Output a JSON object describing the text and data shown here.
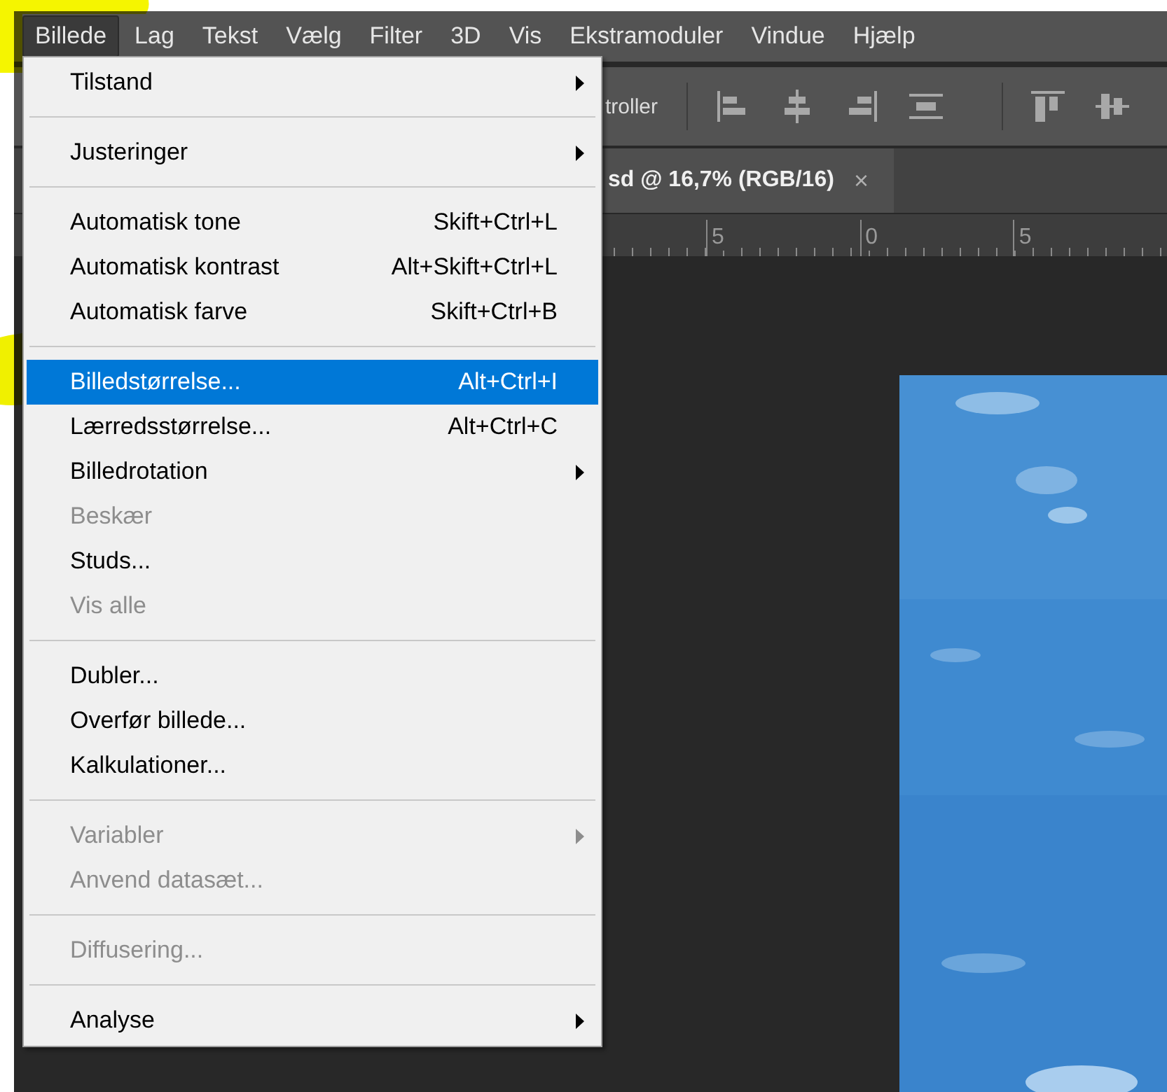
{
  "menubar": {
    "items": [
      {
        "label": "Billede",
        "selected": true
      },
      {
        "label": "Lag",
        "selected": false
      },
      {
        "label": "Tekst",
        "selected": false
      },
      {
        "label": "Vælg",
        "selected": false
      },
      {
        "label": "Filter",
        "selected": false
      },
      {
        "label": "3D",
        "selected": false
      },
      {
        "label": "Vis",
        "selected": false
      },
      {
        "label": "Ekstramoduler",
        "selected": false
      },
      {
        "label": "Vindue",
        "selected": false
      },
      {
        "label": "Hjælp",
        "selected": false
      }
    ]
  },
  "options_bar": {
    "label": "troller"
  },
  "document_tab": {
    "title": "sd @ 16,7% (RGB/16)",
    "close": "×"
  },
  "ruler": {
    "labels": [
      "5",
      "0",
      "5"
    ]
  },
  "menu": {
    "items": [
      {
        "kind": "item",
        "label": "Tilstand",
        "submenu": true,
        "disabled": false,
        "selected": false
      },
      {
        "kind": "separator"
      },
      {
        "kind": "item",
        "label": "Justeringer",
        "submenu": true,
        "disabled": false,
        "selected": false
      },
      {
        "kind": "separator"
      },
      {
        "kind": "item",
        "label": "Automatisk tone",
        "shortcut": "Skift+Ctrl+L",
        "submenu": false,
        "disabled": false,
        "selected": false
      },
      {
        "kind": "item",
        "label": "Automatisk kontrast",
        "shortcut": "Alt+Skift+Ctrl+L",
        "submenu": false,
        "disabled": false,
        "selected": false
      },
      {
        "kind": "item",
        "label": "Automatisk farve",
        "shortcut": "Skift+Ctrl+B",
        "submenu": false,
        "disabled": false,
        "selected": false
      },
      {
        "kind": "separator"
      },
      {
        "kind": "item",
        "label": "Billedstørrelse...",
        "shortcut": "Alt+Ctrl+I",
        "submenu": false,
        "disabled": false,
        "selected": true
      },
      {
        "kind": "item",
        "label": "Lærredsstørrelse...",
        "shortcut": "Alt+Ctrl+C",
        "submenu": false,
        "disabled": false,
        "selected": false
      },
      {
        "kind": "item",
        "label": "Billedrotation",
        "submenu": true,
        "disabled": false,
        "selected": false
      },
      {
        "kind": "item",
        "label": "Beskær",
        "submenu": false,
        "disabled": true,
        "selected": false
      },
      {
        "kind": "item",
        "label": "Studs...",
        "submenu": false,
        "disabled": false,
        "selected": false
      },
      {
        "kind": "item",
        "label": "Vis alle",
        "submenu": false,
        "disabled": true,
        "selected": false
      },
      {
        "kind": "separator"
      },
      {
        "kind": "item",
        "label": "Dubler...",
        "submenu": false,
        "disabled": false,
        "selected": false
      },
      {
        "kind": "item",
        "label": "Overfør billede...",
        "submenu": false,
        "disabled": false,
        "selected": false
      },
      {
        "kind": "item",
        "label": "Kalkulationer...",
        "submenu": false,
        "disabled": false,
        "selected": false
      },
      {
        "kind": "separator"
      },
      {
        "kind": "item",
        "label": "Variabler",
        "submenu": true,
        "disabled": true,
        "selected": false
      },
      {
        "kind": "item",
        "label": "Anvend datasæt...",
        "submenu": false,
        "disabled": true,
        "selected": false
      },
      {
        "kind": "separator"
      },
      {
        "kind": "item",
        "label": "Diffusering...",
        "submenu": false,
        "disabled": true,
        "selected": false
      },
      {
        "kind": "separator"
      },
      {
        "kind": "item",
        "label": "Analyse",
        "submenu": true,
        "disabled": false,
        "selected": false
      }
    ]
  }
}
